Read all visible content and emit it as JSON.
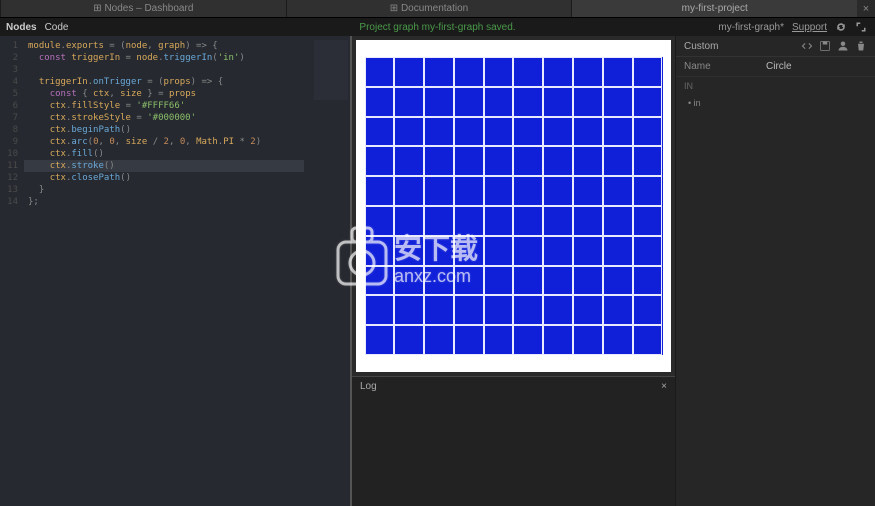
{
  "colors": {
    "canvas_fill": "#1020d8",
    "save_msg": "#4a9a4a"
  },
  "top_tabs": [
    {
      "label": "⊞ Nodes – Dashboard",
      "active": false
    },
    {
      "label": "⊞ Documentation",
      "active": false
    },
    {
      "label": "my-first-project",
      "active": true
    }
  ],
  "toolbar": {
    "mode_a": "Nodes",
    "mode_b": "Code",
    "save_msg": "Project graph my-first-graph saved.",
    "graph_name": "my-first-graph*",
    "support": "Support"
  },
  "editor": {
    "lines": [
      [
        [
          "module",
          "t-var"
        ],
        [
          ".",
          "t-punc"
        ],
        [
          "exports",
          "t-var"
        ],
        [
          " = (",
          "t-op"
        ],
        [
          "node",
          "t-var"
        ],
        [
          ", ",
          "t-punc"
        ],
        [
          "graph",
          "t-var"
        ],
        [
          ") => {",
          "t-op"
        ]
      ],
      [
        [
          "  ",
          "t-op"
        ],
        [
          "const ",
          "t-kw"
        ],
        [
          "triggerIn",
          "t-var"
        ],
        [
          " = ",
          "t-op"
        ],
        [
          "node",
          "t-var"
        ],
        [
          ".",
          "t-punc"
        ],
        [
          "triggerIn",
          "t-fn"
        ],
        [
          "(",
          "t-punc"
        ],
        [
          "'in'",
          "t-str"
        ],
        [
          ")",
          "t-punc"
        ]
      ],
      [
        [
          "",
          ""
        ]
      ],
      [
        [
          "  ",
          "t-op"
        ],
        [
          "triggerIn",
          "t-var"
        ],
        [
          ".",
          "t-punc"
        ],
        [
          "onTrigger",
          "t-fn"
        ],
        [
          " = (",
          "t-op"
        ],
        [
          "props",
          "t-var"
        ],
        [
          ") => {",
          "t-op"
        ]
      ],
      [
        [
          "    ",
          "t-op"
        ],
        [
          "const ",
          "t-kw"
        ],
        [
          "{ ",
          "t-punc"
        ],
        [
          "ctx",
          "t-var"
        ],
        [
          ", ",
          "t-punc"
        ],
        [
          "size",
          "t-var"
        ],
        [
          " } = ",
          "t-op"
        ],
        [
          "props",
          "t-var"
        ]
      ],
      [
        [
          "    ",
          "t-op"
        ],
        [
          "ctx",
          "t-var"
        ],
        [
          ".",
          "t-punc"
        ],
        [
          "fillStyle",
          "t-var"
        ],
        [
          " = ",
          "t-op"
        ],
        [
          "'#FFFF66'",
          "t-str"
        ]
      ],
      [
        [
          "    ",
          "t-op"
        ],
        [
          "ctx",
          "t-var"
        ],
        [
          ".",
          "t-punc"
        ],
        [
          "strokeStyle",
          "t-var"
        ],
        [
          " = ",
          "t-op"
        ],
        [
          "'#000000'",
          "t-str"
        ]
      ],
      [
        [
          "    ",
          "t-op"
        ],
        [
          "ctx",
          "t-var"
        ],
        [
          ".",
          "t-punc"
        ],
        [
          "beginPath",
          "t-fn"
        ],
        [
          "()",
          "t-punc"
        ]
      ],
      [
        [
          "    ",
          "t-op"
        ],
        [
          "ctx",
          "t-var"
        ],
        [
          ".",
          "t-punc"
        ],
        [
          "arc",
          "t-fn"
        ],
        [
          "(",
          "t-punc"
        ],
        [
          "0",
          "t-num"
        ],
        [
          ", ",
          "t-punc"
        ],
        [
          "0",
          "t-num"
        ],
        [
          ", ",
          "t-punc"
        ],
        [
          "size",
          "t-var"
        ],
        [
          " / ",
          "t-op"
        ],
        [
          "2",
          "t-num"
        ],
        [
          ", ",
          "t-punc"
        ],
        [
          "0",
          "t-num"
        ],
        [
          ", ",
          "t-punc"
        ],
        [
          "Math",
          "t-var"
        ],
        [
          ".",
          "t-punc"
        ],
        [
          "PI",
          "t-var"
        ],
        [
          " * ",
          "t-op"
        ],
        [
          "2",
          "t-num"
        ],
        [
          ")",
          "t-punc"
        ]
      ],
      [
        [
          "    ",
          "t-op"
        ],
        [
          "ctx",
          "t-var"
        ],
        [
          ".",
          "t-punc"
        ],
        [
          "fill",
          "t-fn"
        ],
        [
          "()",
          "t-punc"
        ]
      ],
      [
        [
          "    ",
          "t-op"
        ],
        [
          "ctx",
          "t-var"
        ],
        [
          ".",
          "t-punc"
        ],
        [
          "stroke",
          "t-fn"
        ],
        [
          "()",
          "t-punc"
        ]
      ],
      [
        [
          "    ",
          "t-op"
        ],
        [
          "ctx",
          "t-var"
        ],
        [
          ".",
          "t-punc"
        ],
        [
          "closePath",
          "t-fn"
        ],
        [
          "()",
          "t-punc"
        ]
      ],
      [
        [
          "  }",
          "t-op"
        ]
      ],
      [
        [
          "};",
          "t-op"
        ]
      ]
    ],
    "highlighted_line_index": 10
  },
  "log": {
    "title": "Log",
    "close": "×"
  },
  "inspector": {
    "header": "Custom",
    "name_label": "Name",
    "name_value": "Circle",
    "in_label": "IN",
    "in_items": [
      "in"
    ]
  },
  "watermark_text": "安下载 anxz.com"
}
